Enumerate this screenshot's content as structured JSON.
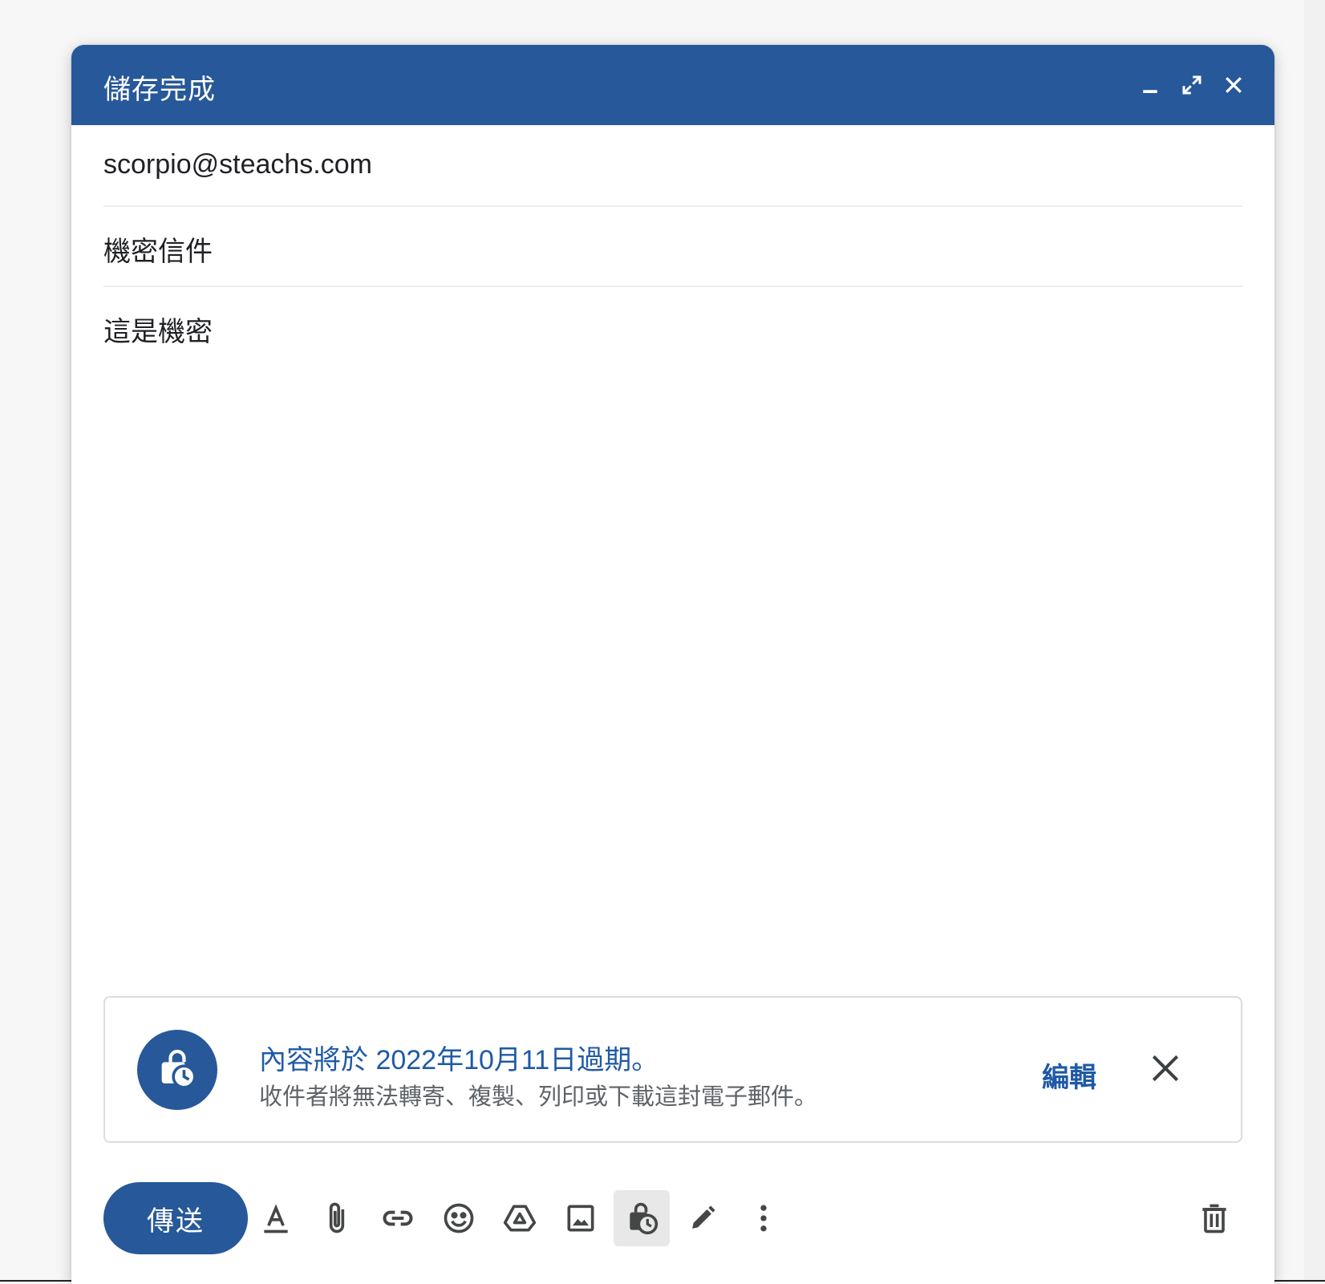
{
  "window": {
    "title": "儲存完成",
    "controls": [
      "minimize-icon",
      "expand-icon",
      "close-icon"
    ]
  },
  "compose": {
    "to": "scorpio@steachs.com",
    "subject": "機密信件",
    "body": "這是機密"
  },
  "confidential_notice": {
    "icon": "lock-clock-icon",
    "title": "內容將於 2022年10月11日過期。",
    "subtitle": "收件者將無法轉寄、複製、列印或下載這封電子郵件。",
    "edit_label": "編輯",
    "close_icon": "close-icon"
  },
  "toolbar": {
    "send_label": "傳送",
    "tools": [
      "format-text-icon",
      "attach-icon",
      "link-icon",
      "emoji-icon",
      "drive-icon",
      "image-icon",
      "confidential-mode-icon",
      "signature-icon",
      "more-options-icon"
    ],
    "trash_icon": "trash-icon"
  },
  "colors": {
    "header": "#275899",
    "accent_text": "#1f5aa6",
    "icon": "#444746"
  }
}
